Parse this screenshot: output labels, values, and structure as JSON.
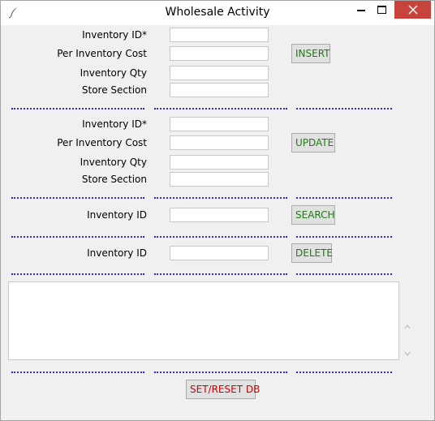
{
  "window": {
    "title": "Wholesale Activity"
  },
  "insert_section": {
    "fields": [
      {
        "label": "Inventory ID*",
        "value": ""
      },
      {
        "label": "Per Inventory Cost",
        "value": ""
      },
      {
        "label": "Inventory Qty",
        "value": ""
      },
      {
        "label": "Store Section",
        "value": ""
      }
    ],
    "button_label": "INSERT"
  },
  "update_section": {
    "fields": [
      {
        "label": "Inventory ID*",
        "value": ""
      },
      {
        "label": "Per Inventory Cost",
        "value": ""
      },
      {
        "label": "Inventory Qty",
        "value": ""
      },
      {
        "label": "Store Section",
        "value": ""
      }
    ],
    "button_label": "UPDATE"
  },
  "search_section": {
    "label": "Inventory ID",
    "value": "",
    "button_label": "SEARCH"
  },
  "delete_section": {
    "label": "Inventory ID",
    "value": "",
    "button_label": "DELETE"
  },
  "results_list": {
    "items": []
  },
  "reset_button_label": "SET/RESET DB",
  "colors": {
    "action_button_text": "#1f7a14",
    "reset_button_text": "#cc0000",
    "separator": "#2b2bd6",
    "close_button": "#c7443a"
  },
  "icons": {
    "app": "feather-icon",
    "minimize": "minimize-icon",
    "maximize": "maximize-icon",
    "close": "close-icon",
    "scroll_up": "chevron-up-icon",
    "scroll_down": "chevron-down-icon"
  }
}
